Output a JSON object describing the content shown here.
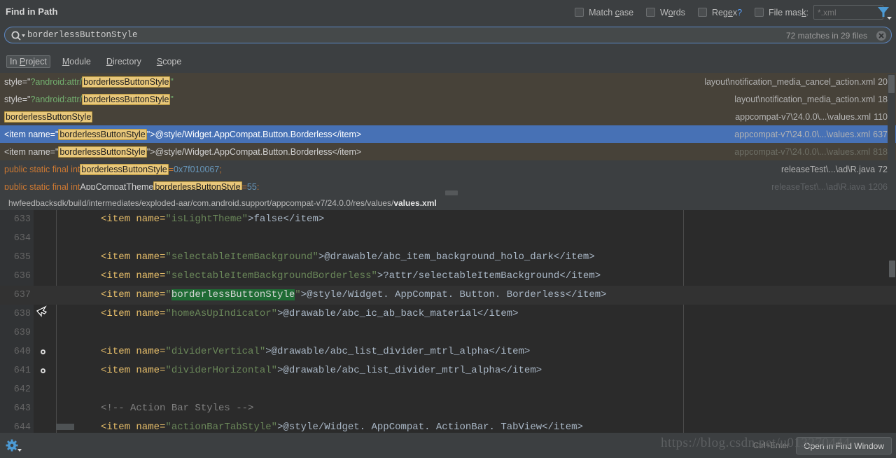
{
  "window": {
    "title": "Find in Path"
  },
  "options": {
    "match_case": {
      "label": "Match case",
      "mnemonic": "c",
      "checked": false
    },
    "words": {
      "label": "Words",
      "mnemonic": "o",
      "checked": false
    },
    "regex": {
      "label": "Regex",
      "mnemonic": "e",
      "suffix": "?",
      "checked": false
    },
    "file_mask": {
      "label": "File mask:",
      "mnemonic": "k",
      "checked": false,
      "placeholder": "*.xml",
      "value": ""
    },
    "filter_icon": "filter-funnel-icon"
  },
  "search": {
    "icon": "search-magnifier-icon",
    "value": "borderlessButtonStyle",
    "placeholder": "",
    "match_count": "72 matches in 29 files",
    "clear_icon": "clear-circle-icon"
  },
  "scopes": {
    "selected": "In Project",
    "items": [
      {
        "label": "In Project",
        "mnemonic": "P",
        "selected": true
      },
      {
        "label": "Module",
        "mnemonic": "M",
        "selected": false
      },
      {
        "label": "Directory",
        "mnemonic": "D",
        "selected": false
      },
      {
        "label": "Scope",
        "mnemonic": "S",
        "selected": false
      }
    ]
  },
  "results": {
    "rows": [
      {
        "kind": "xml",
        "selected": false,
        "dim_path": false,
        "segments": [
          {
            "text": "style=\"",
            "style": "plain"
          },
          {
            "text": "?android:attr/",
            "style": "attr"
          },
          {
            "text": "borderlessButtonStyle",
            "style": "highlight"
          },
          {
            "text": "\"",
            "style": "attr"
          }
        ],
        "path": "layout\\notification_media_cancel_action.xml",
        "line": "20"
      },
      {
        "kind": "xml",
        "selected": false,
        "dim_path": false,
        "segments": [
          {
            "text": "style=\"",
            "style": "plain"
          },
          {
            "text": "?android:attr/",
            "style": "attr"
          },
          {
            "text": "borderlessButtonStyle",
            "style": "highlight"
          },
          {
            "text": "\"",
            "style": "attr"
          }
        ],
        "path": "layout\\notification_media_action.xml",
        "line": "18"
      },
      {
        "kind": "xml",
        "selected": false,
        "dim_path": false,
        "segments": [
          {
            "text": "borderlessButtonStyle",
            "style": "highlight"
          }
        ],
        "path": "appcompat-v7\\24.0.0\\...\\values.xml",
        "line": "110"
      },
      {
        "kind": "xml",
        "selected": true,
        "dim_path": false,
        "segments": [
          {
            "text": "<item name=\"",
            "style": "plain"
          },
          {
            "text": "borderlessButtonStyle",
            "style": "highlight"
          },
          {
            "text": "\">@style/Widget.AppCompat.Button.Borderless</item>",
            "style": "plain"
          }
        ],
        "path": "appcompat-v7\\24.0.0\\...\\values.xml",
        "line": "637"
      },
      {
        "kind": "xml",
        "selected": false,
        "dim_path": true,
        "segments": [
          {
            "text": "<item name=\"",
            "style": "plain"
          },
          {
            "text": "borderlessButtonStyle",
            "style": "highlight"
          },
          {
            "text": "\">@style/Widget.AppCompat.Button.Borderless</item>",
            "style": "plain"
          }
        ],
        "path": "appcompat-v7\\24.0.0\\...\\values.xml",
        "line": "818"
      },
      {
        "kind": "java",
        "selected": false,
        "dim_path": false,
        "segments": [
          {
            "text": "public static final int ",
            "style": "kw"
          },
          {
            "text": "borderlessButtonStyle",
            "style": "highlight"
          },
          {
            "text": " = ",
            "style": "kw"
          },
          {
            "text": "0x7f010067",
            "style": "num"
          },
          {
            "text": ";",
            "style": "kw"
          }
        ],
        "path": "releaseTest\\...\\ad\\R.java",
        "line": "72"
      },
      {
        "kind": "java",
        "selected": false,
        "dim_path": true,
        "segments": [
          {
            "text": "public static final int ",
            "style": "kw"
          },
          {
            "text": "AppCompatTheme",
            "style": "white"
          },
          {
            "text": " ",
            "style": "kw"
          },
          {
            "text": "borderlessButtonStyle",
            "style": "highlight"
          },
          {
            "text": " = ",
            "style": "kw"
          },
          {
            "text": "55",
            "style": "num"
          },
          {
            "text": ";",
            "style": "kw"
          }
        ],
        "path": "releaseTest\\...\\ad\\R.java",
        "line": "1206"
      }
    ]
  },
  "path_bar": {
    "prefix": "hwfeedbacksdk/build/intermediates/exploded-aar/com.android.support/appcompat-v7/24.0.0/res/values/",
    "file": "values.xml"
  },
  "code": {
    "lines": [
      {
        "number": "633",
        "segments": [
          {
            "text": "<item name=",
            "style": "tag"
          },
          {
            "text": "\"isLightTheme\"",
            "style": "attrval"
          },
          {
            "text": ">false</item>",
            "style": "text"
          }
        ],
        "highlighted": false,
        "marker": false,
        "fold": false
      },
      {
        "number": "634",
        "segments": [],
        "highlighted": false,
        "marker": false,
        "fold": false
      },
      {
        "number": "635",
        "segments": [
          {
            "text": "<item name=",
            "style": "tag"
          },
          {
            "text": "\"selectableItemBackground\"",
            "style": "attrval"
          },
          {
            "text": ">@drawable/abc_item_background_holo_dark</item>",
            "style": "text"
          }
        ],
        "highlighted": false,
        "marker": false,
        "fold": false
      },
      {
        "number": "636",
        "segments": [
          {
            "text": "<item name=",
            "style": "tag"
          },
          {
            "text": "\"selectableItemBackgroundBorderless\"",
            "style": "attrval"
          },
          {
            "text": ">?attr/selectableItemBackground</item>",
            "style": "text"
          }
        ],
        "highlighted": false,
        "marker": false,
        "fold": false
      },
      {
        "number": "637",
        "segments": [
          {
            "text": "<item name=",
            "style": "tag"
          },
          {
            "text": "\"",
            "style": "attrval"
          },
          {
            "text": "borderlessButtonStyle",
            "style": "codehl"
          },
          {
            "text": "\"",
            "style": "attrval"
          },
          {
            "text": ">@style/Widget. AppCompat. Button. Borderless</item>",
            "style": "text"
          }
        ],
        "highlighted": true,
        "marker": false,
        "fold": false
      },
      {
        "number": "638",
        "segments": [
          {
            "text": "<item name=",
            "style": "tag"
          },
          {
            "text": "\"homeAsUpIndicator\"",
            "style": "attrval"
          },
          {
            "text": ">@drawable/abc_ic_ab_back_material</item>",
            "style": "text"
          }
        ],
        "highlighted": false,
        "marker": false,
        "fold": false
      },
      {
        "number": "639",
        "segments": [],
        "highlighted": false,
        "marker": false,
        "fold": false
      },
      {
        "number": "640",
        "segments": [
          {
            "text": "<item name=",
            "style": "tag"
          },
          {
            "text": "\"dividerVertical\"",
            "style": "attrval"
          },
          {
            "text": ">@drawable/abc_list_divider_mtrl_alpha</item>",
            "style": "text"
          }
        ],
        "highlighted": false,
        "marker": true,
        "fold": false
      },
      {
        "number": "641",
        "segments": [
          {
            "text": "<item name=",
            "style": "tag"
          },
          {
            "text": "\"dividerHorizontal\"",
            "style": "attrval"
          },
          {
            "text": ">@drawable/abc_list_divider_mtrl_alpha</item>",
            "style": "text"
          }
        ],
        "highlighted": false,
        "marker": true,
        "fold": false
      },
      {
        "number": "642",
        "segments": [],
        "highlighted": false,
        "marker": false,
        "fold": false
      },
      {
        "number": "643",
        "segments": [
          {
            "text": "<!-- Action Bar Styles -->",
            "style": "comment"
          }
        ],
        "highlighted": false,
        "marker": false,
        "fold": false
      },
      {
        "number": "644",
        "segments": [
          {
            "text": "<item name=",
            "style": "tag"
          },
          {
            "text": "\"actionBarTabStyle\"",
            "style": "attrval"
          },
          {
            "text": ">@style/Widget. AppCompat. ActionBar. TabView</item>",
            "style": "text"
          }
        ],
        "highlighted": false,
        "marker": false,
        "fold": true
      }
    ]
  },
  "bottom": {
    "settings_icon": "gear-icon",
    "shortcut_hint": "Ctrl+Enter",
    "open_button": "Open in Find Window",
    "watermark": "https://blog.csdn.net/u013270444"
  },
  "colors": {
    "accent_blue": "#4771b5",
    "xml_row_bg": "#474239",
    "java_row_bg": "#3c3f41",
    "highlight_yellow": "#e8c77a",
    "code_bg": "#2b2b2b",
    "code_match_green": "#1f6b34",
    "icon_blue": "#589df6"
  }
}
